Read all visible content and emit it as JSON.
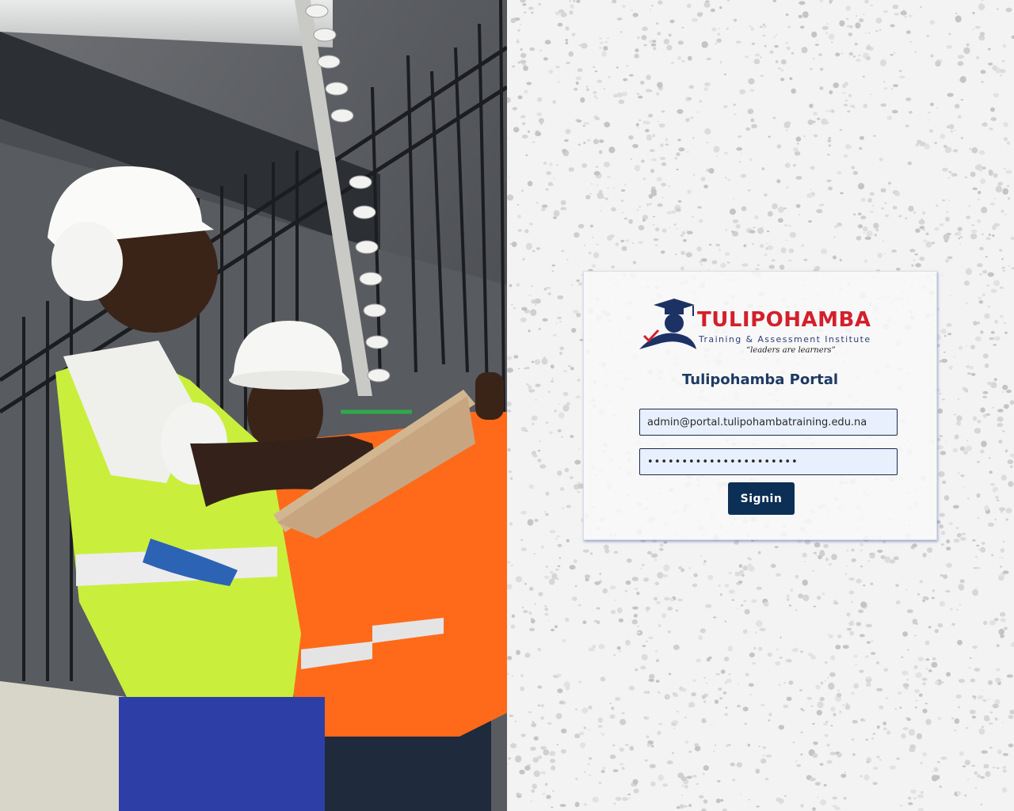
{
  "photo": {
    "icon": "construction-workers-photo"
  },
  "logo": {
    "icon": "graduate-cap-logo",
    "name": "TULIPOHAMBA",
    "subtitle": "Training & Assessment Institute",
    "motto": "“leaders are learners”"
  },
  "login": {
    "title": "Tulipohamba Portal",
    "email_value": "admin@portal.tulipohambatraining.edu.na",
    "password_value": "password123!abcdefghij",
    "signin_label": "Signin"
  },
  "colors": {
    "brand_red": "#d3202b",
    "brand_navy": "#0c2f55",
    "input_fill": "#e8f0fe"
  }
}
